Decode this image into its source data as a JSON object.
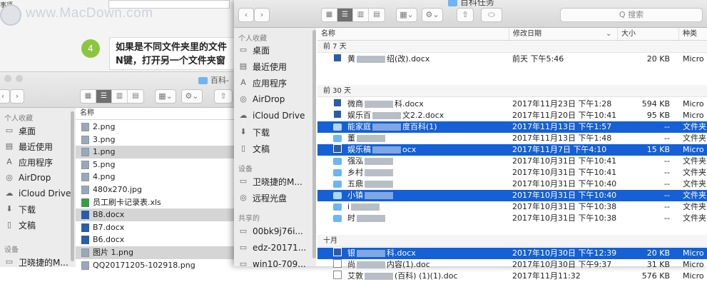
{
  "background": {
    "watermark": "www.MacDown.com",
    "tab_fragment": "",
    "top_label": "事项",
    "step_number": "4",
    "step_text_line1": "如果是不同文件夹里的文件",
    "step_text_line2": "N键，打开另一个文件夹窗"
  },
  "back_window": {
    "title": "百科-",
    "sidebar": {
      "favorites_heading": "个人收藏",
      "items": [
        {
          "label": "桌面",
          "icon": "desktop-icon"
        },
        {
          "label": "最近使用",
          "icon": "recents-icon"
        },
        {
          "label": "应用程序",
          "icon": "applications-icon"
        },
        {
          "label": "AirDrop",
          "icon": "airdrop-icon"
        },
        {
          "label": "iCloud Drive",
          "icon": "cloud-icon"
        },
        {
          "label": "下载",
          "icon": "download-icon"
        },
        {
          "label": "文稿",
          "icon": "documents-icon"
        }
      ],
      "devices_heading": "设备",
      "device": "卫晓捷的M..."
    },
    "column_name": "名称",
    "files": [
      {
        "name": "2.png",
        "type": "img",
        "selected": false
      },
      {
        "name": "3.png",
        "type": "img",
        "selected": false
      },
      {
        "name": "1.png",
        "type": "img",
        "selected": true
      },
      {
        "name": "5.png",
        "type": "img",
        "selected": false
      },
      {
        "name": "4.png",
        "type": "img",
        "selected": false
      },
      {
        "name": "480x270.jpg",
        "type": "img",
        "selected": false
      },
      {
        "name": "员工刷卡记录表.xls",
        "type": "x",
        "selected": false
      },
      {
        "name": "B8.docx",
        "type": "w",
        "selected": true
      },
      {
        "name": "B7.docx",
        "type": "w",
        "selected": false
      },
      {
        "name": "B6.docx",
        "type": "w",
        "selected": false
      },
      {
        "name": "图片 1.png",
        "type": "img",
        "selected": true
      },
      {
        "name": "QQ20171205-102918.png",
        "type": "img",
        "selected": false
      }
    ]
  },
  "front_window": {
    "title": "百科任务",
    "search_placeholder": "Q 搜索",
    "sidebar": {
      "favorites_heading": "个人收藏",
      "items": [
        {
          "label": "桌面",
          "icon": "desktop-icon"
        },
        {
          "label": "最近使用",
          "icon": "recents-icon"
        },
        {
          "label": "应用程序",
          "icon": "applications-icon"
        },
        {
          "label": "AirDrop",
          "icon": "airdrop-icon"
        },
        {
          "label": "iCloud Drive",
          "icon": "cloud-icon"
        },
        {
          "label": "下载",
          "icon": "download-icon"
        },
        {
          "label": "文稿",
          "icon": "documents-icon"
        }
      ],
      "devices_heading": "设备",
      "devices": [
        {
          "label": "卫晓捷的M...",
          "icon": "computer-icon"
        },
        {
          "label": "远程光盘",
          "icon": "disc-icon"
        }
      ],
      "shared_heading": "共享的",
      "shared": [
        {
          "label": "00bk9j76i...",
          "icon": "monitor-icon"
        },
        {
          "label": "edz-20171...",
          "icon": "monitor-icon"
        },
        {
          "label": "win10-709...",
          "icon": "monitor-icon"
        }
      ]
    },
    "columns": {
      "name": "名称",
      "date": "修改日期",
      "size": "大小",
      "kind": "种类"
    },
    "groups": [
      {
        "label": "前 7 天"
      },
      {
        "label": "前 30 天"
      },
      {
        "label": "十月"
      }
    ],
    "rows": [
      {
        "prefix": "黄",
        "suffix": "绍(改).docx",
        "date": "前天 下午5:46",
        "size": "20 KB",
        "kind": "Micro",
        "icon": "w",
        "selected": false,
        "group": 0
      },
      {
        "prefix": "微商",
        "suffix": "科.docx",
        "date": "2017年11月23日 下午1:28",
        "size": "594 KB",
        "kind": "Micro",
        "icon": "w",
        "selected": false,
        "group": 1
      },
      {
        "prefix": "娱乐百",
        "suffix": "文2.2.docx",
        "date": "2017年11月20日 下午10:41",
        "size": "95 KB",
        "kind": "Micro",
        "icon": "w",
        "selected": false,
        "group": 1
      },
      {
        "prefix": "能家庭",
        "suffix": "度百科(1)",
        "date": "2017年11月13日 下午1:57",
        "size": "--",
        "kind": "文件夹",
        "icon": "f",
        "selected": true,
        "group": 1
      },
      {
        "prefix": "董",
        "suffix": "",
        "date": "2017年11月13日 下午1:48",
        "size": "--",
        "kind": "文件夹",
        "icon": "f",
        "selected": false,
        "group": 1
      },
      {
        "prefix": "娱乐稿",
        "suffix": "ocx",
        "date": "2017年11月7日 下午4:10",
        "size": "15 KB",
        "kind": "Micro",
        "icon": "w",
        "selected": true,
        "group": 1
      },
      {
        "prefix": "强泓",
        "suffix": "",
        "date": "2017年10月31日 下午10:41",
        "size": "--",
        "kind": "文件夹",
        "icon": "f",
        "selected": false,
        "group": 1
      },
      {
        "prefix": "乡村",
        "suffix": "",
        "date": "2017年10月31日 下午10:41",
        "size": "--",
        "kind": "文件夹",
        "icon": "f",
        "selected": false,
        "group": 1
      },
      {
        "prefix": "五鼎",
        "suffix": "",
        "date": "2017年10月31日 下午10:40",
        "size": "--",
        "kind": "文件夹",
        "icon": "f",
        "selected": false,
        "group": 1
      },
      {
        "prefix": "小镇",
        "suffix": "",
        "date": "2017年10月31日 下午10:40",
        "size": "--",
        "kind": "文件夹",
        "icon": "f",
        "selected": true,
        "group": 1
      },
      {
        "prefix": "i",
        "suffix": "",
        "date": "2017年10月31日 下午10:38",
        "size": "--",
        "kind": "文件夹",
        "icon": "f",
        "selected": false,
        "group": 1
      },
      {
        "prefix": "时",
        "suffix": "",
        "date": "2017年10月31日 下午10:38",
        "size": "--",
        "kind": "文件夹",
        "icon": "f",
        "selected": false,
        "group": 1
      },
      {
        "prefix": "银",
        "suffix": "科.docx",
        "date": "2017年10月30日 下午12:39",
        "size": "20 KB",
        "kind": "Micro",
        "icon": "w",
        "selected": true,
        "group": 2
      },
      {
        "prefix": "尚",
        "suffix": "内容(1).doc",
        "date": "2017年10月30日 下午9:37",
        "size": "31 KB",
        "kind": "Micro",
        "icon": "d",
        "selected": false,
        "group": 2
      },
      {
        "prefix": "艾敦",
        "suffix": "(百科) (1)(1).doc",
        "date": "2017年11月11:32",
        "size": "576 KB",
        "kind": "Micro",
        "icon": "d",
        "selected": false,
        "group": 2
      }
    ]
  }
}
